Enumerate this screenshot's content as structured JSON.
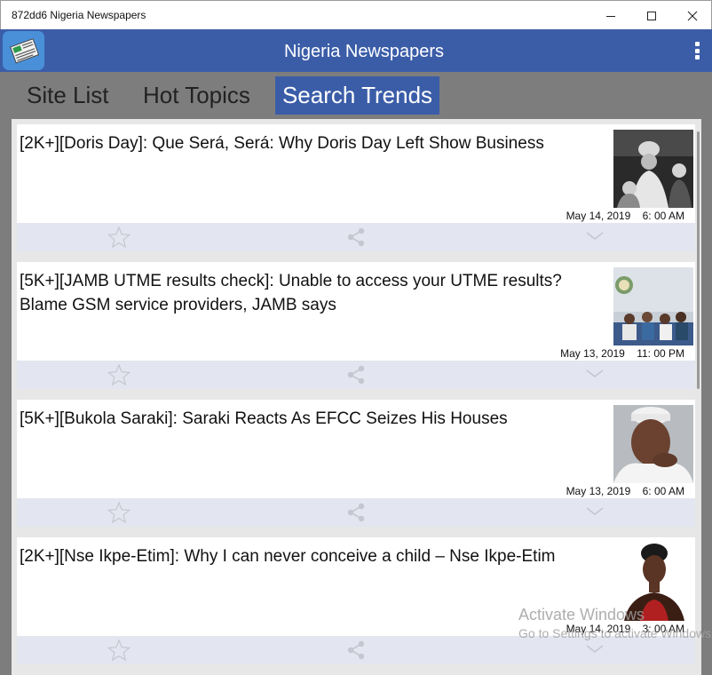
{
  "window": {
    "title": "872dd6 Nigeria Newspapers",
    "controls": {
      "minimize_icon": "minimize-icon",
      "maximize_icon": "maximize-icon",
      "close_icon": "close-icon"
    }
  },
  "appbar": {
    "title": "Nigeria Newspapers",
    "logo_icon": "newspaper-icon",
    "menu_icon": "more-vertical-icon",
    "color": "#3b5da8"
  },
  "tabs": [
    {
      "label": "Site List",
      "selected": false
    },
    {
      "label": "Hot Topics",
      "selected": false
    },
    {
      "label": "Search Trends",
      "selected": true
    }
  ],
  "articles": [
    {
      "headline": "[2K+][Doris Day]: Que Será, Será: Why Doris Day Left Show Business",
      "date": "May 14, 2019",
      "time": "6: 00 AM"
    },
    {
      "headline": "[5K+][JAMB UTME results check]: Unable to access your UTME results? Blame GSM service providers, JAMB says",
      "date": "May 13, 2019",
      "time": "11: 00 PM"
    },
    {
      "headline": "[5K+][Bukola Saraki]: Saraki Reacts As EFCC Seizes His Houses",
      "date": "May 13, 2019",
      "time": "6: 00 AM"
    },
    {
      "headline": "[2K+][Nse Ikpe-Etim]: Why I can never conceive a child – Nse Ikpe-Etim",
      "date": "May 14, 2019",
      "time": "3: 00 AM"
    }
  ],
  "watermark": {
    "line1": "Activate Windows",
    "line2": "Go to Settings to activate Windows."
  }
}
